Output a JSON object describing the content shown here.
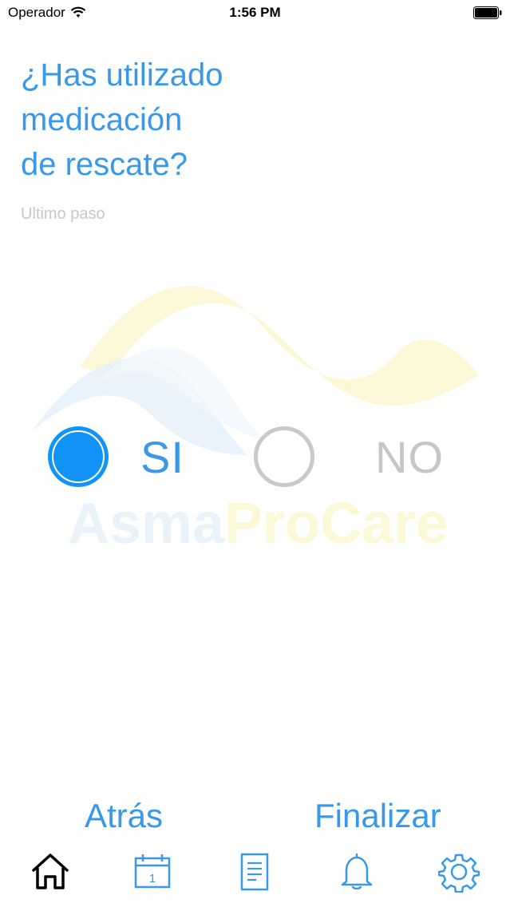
{
  "status_bar": {
    "carrier": "Operador",
    "time": "1:56 PM"
  },
  "question": {
    "line1": "¿Has utilizado",
    "line2": "medicación",
    "line3": "de rescate?",
    "step": "Ultimo paso"
  },
  "options": {
    "yes_label": "SI",
    "no_label": "NO",
    "selected": "SI"
  },
  "watermark": {
    "brand_part1": "Asma",
    "brand_part2": "ProCare"
  },
  "actions": {
    "back_label": "Atrás",
    "finish_label": "Finalizar"
  },
  "tab_bar": {
    "items": [
      {
        "icon": "home-icon",
        "active": true
      },
      {
        "icon": "calendar-icon",
        "active": false,
        "badge": "1"
      },
      {
        "icon": "document-icon",
        "active": false
      },
      {
        "icon": "bell-icon",
        "active": false
      },
      {
        "icon": "gear-icon",
        "active": false
      }
    ]
  },
  "colors": {
    "accent": "#3a98e8",
    "radio_selected": "#1193f8",
    "inactive": "#c6c6c6"
  }
}
